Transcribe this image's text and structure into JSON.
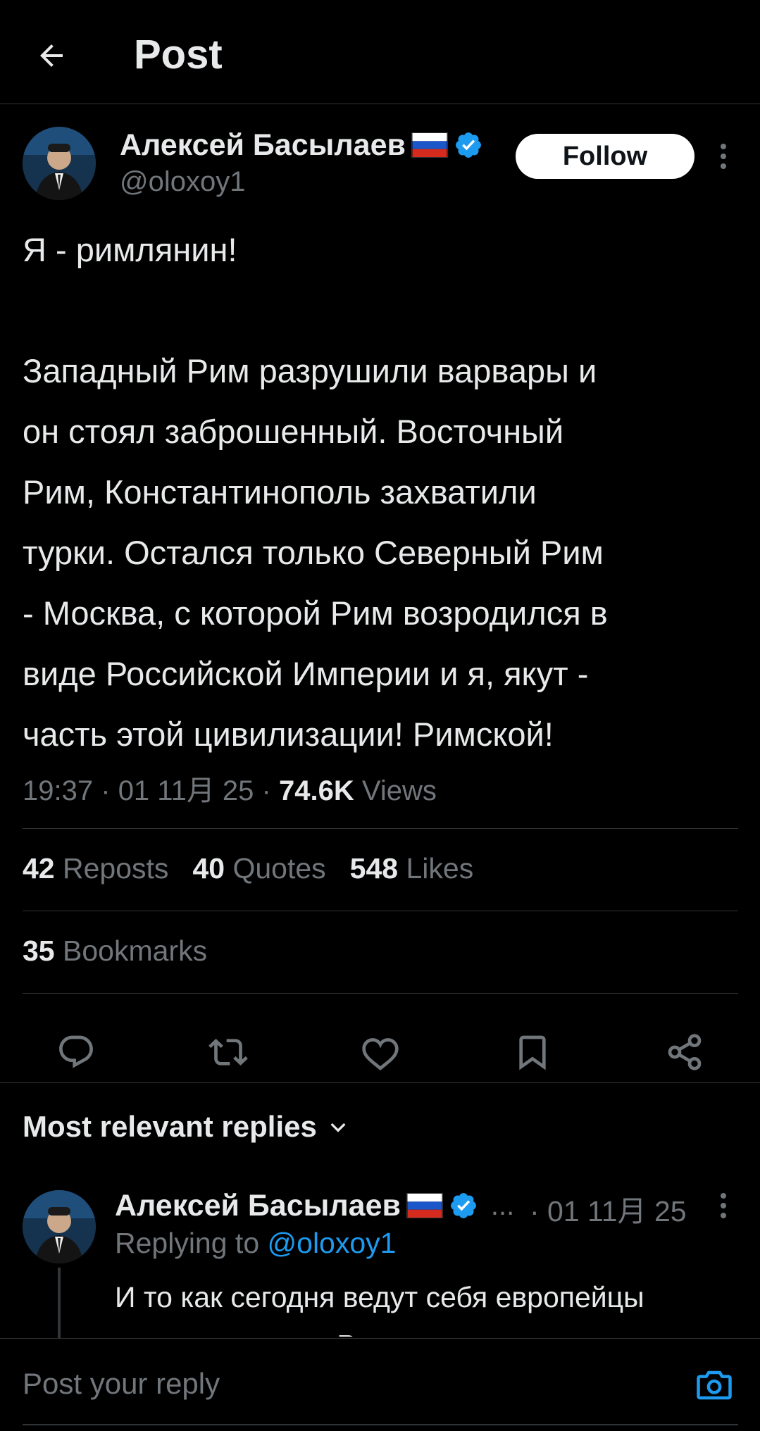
{
  "header": {
    "title": "Post",
    "back_icon": "arrow-left-icon"
  },
  "post": {
    "author_name": "Алексей Басылаев",
    "author_flag": "russia-flag-icon",
    "verified_icon": "verified-badge-icon",
    "handle": "@oloxoy1",
    "follow_label": "Follow",
    "text": "Я - римлянин!\n\nЗападный Рим разрушили варвары и\nон стоял заброшенный. Восточный\nРим, Константинополь захватили\nтурки. Остался только Северный Рим\n- Москва, с которой Рим возродился в\nвиде Российской Империи и я, якут -\nчасть этой цивилизации! Римской!",
    "time": "19:37",
    "date": "01 11月 25",
    "separator": "·",
    "views_count": "74.6K",
    "views_label": "Views"
  },
  "stats": {
    "reposts_count": "42",
    "reposts_label": "Reposts",
    "quotes_count": "40",
    "quotes_label": "Quotes",
    "likes_count": "548",
    "likes_label": "Likes",
    "bookmarks_count": "35",
    "bookmarks_label": "Bookmarks"
  },
  "actions": [
    "reply-icon",
    "repost-icon",
    "like-icon",
    "bookmark-icon",
    "share-icon"
  ],
  "replies_section": {
    "title": "Most relevant replies"
  },
  "reply": {
    "author_name": "Алексей Басылаев",
    "ellipsis": "...",
    "date": "· 01 11月 25",
    "replying_prefix": "Replying to ",
    "replying_handle": "@oloxoy1",
    "text": "И то как сегодня ведут себя европейцы\nпо отношению к России это же"
  },
  "composer": {
    "placeholder": "Post your reply"
  },
  "colors": {
    "background": "#000000",
    "accent": "#1d9bf0",
    "text_primary": "#e7e9ea",
    "text_secondary": "#71767b",
    "divider": "#2f3336"
  }
}
